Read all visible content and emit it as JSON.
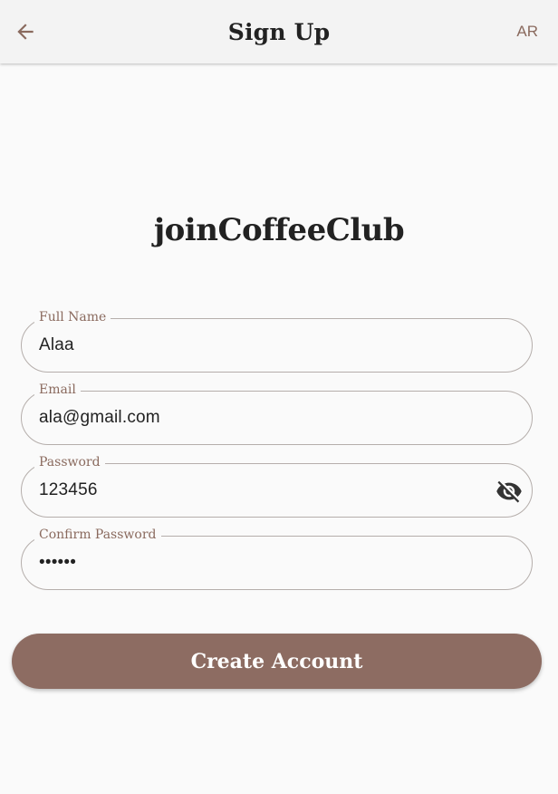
{
  "appbar": {
    "title": "Sign Up",
    "lang_label": "AR"
  },
  "brand": "joinCoffeeClub",
  "form": {
    "full_name": {
      "label": "Full Name",
      "value": "Alaa"
    },
    "email": {
      "label": "Email",
      "value": "ala@gmail.com"
    },
    "password": {
      "label": "Password",
      "value": "123456"
    },
    "confirm_password": {
      "label": "Confirm Password",
      "value": "••••••"
    }
  },
  "submit_label": "Create Account",
  "colors": {
    "accent": "#8d6c62",
    "label": "#8a6a5e",
    "background": "#fafafa",
    "appbar": "#f3f3f3"
  },
  "icons": {
    "back": "arrow-left-icon",
    "visibility": "eye-off-icon"
  }
}
